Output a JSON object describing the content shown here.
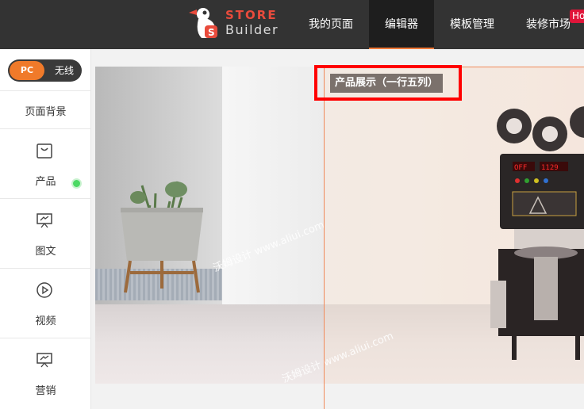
{
  "header": {
    "logo": {
      "line1": "STORE",
      "line2": "Builder"
    },
    "nav": [
      {
        "label": "我的页面",
        "active": false
      },
      {
        "label": "编辑器",
        "active": true
      },
      {
        "label": "模板管理",
        "active": false
      },
      {
        "label": "装修市场",
        "active": false
      }
    ],
    "hot_badge": "Ho"
  },
  "sidebar": {
    "device_toggle": {
      "pc": "PC",
      "wireless": "无线",
      "selected": "PC"
    },
    "items": [
      {
        "label": "页面背景",
        "icon": ""
      },
      {
        "label": "产品",
        "icon": "shopping-bag-icon"
      },
      {
        "label": "图文",
        "icon": "presentation-icon"
      },
      {
        "label": "视频",
        "icon": "play-icon"
      },
      {
        "label": "营销",
        "icon": "presentation-icon"
      }
    ]
  },
  "canvas": {
    "module_label": "产品展示（一行五列）",
    "watermark": "沃姆设计 www.aliui.com"
  },
  "colors": {
    "topbar": "#333333",
    "accent": "#f07a2a",
    "highlight": "#ff0000",
    "module_label_bg": "#7b716c"
  }
}
